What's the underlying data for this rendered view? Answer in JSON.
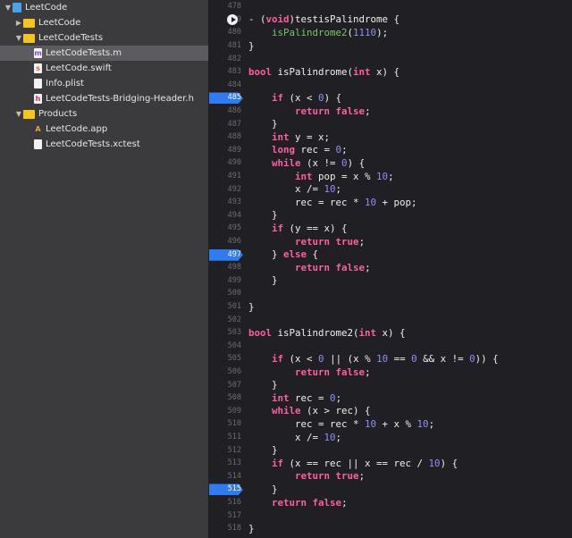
{
  "navigator": {
    "items": [
      {
        "label": "LeetCode",
        "level": 0,
        "icon": "project-icon",
        "disclosure": "open"
      },
      {
        "label": "LeetCode",
        "level": 1,
        "icon": "folder-icon",
        "disclosure": "closed"
      },
      {
        "label": "LeetCodeTests",
        "level": 1,
        "icon": "folder-icon",
        "disclosure": "open"
      },
      {
        "label": "LeetCodeTests.m",
        "level": 2,
        "icon": "objc-file-icon",
        "glyph": "m",
        "selected": true
      },
      {
        "label": "LeetCode.swift",
        "level": 2,
        "icon": "swift-file-icon",
        "glyph": "s"
      },
      {
        "label": "Info.plist",
        "level": 2,
        "icon": "plist-file-icon",
        "glyph": ""
      },
      {
        "label": "LeetCodeTests-Bridging-Header.h",
        "level": 2,
        "icon": "header-file-icon",
        "glyph": "h"
      },
      {
        "label": "Products",
        "level": 1,
        "icon": "folder-icon",
        "disclosure": "open"
      },
      {
        "label": "LeetCode.app",
        "level": 2,
        "icon": "app-icon",
        "glyph": "A"
      },
      {
        "label": "LeetCodeTests.xctest",
        "level": 2,
        "icon": "xctest-bundle-icon",
        "glyph": ""
      }
    ]
  },
  "colors": {
    "keyword": "#fc5fa3",
    "number": "#8f8ff5",
    "function": "#7bc46b",
    "breakpoint": "#2f7bf5"
  },
  "editor": {
    "lines": [
      {
        "n": "478",
        "t": []
      },
      {
        "n": "479",
        "run": true,
        "t": [
          [
            "p",
            "- ("
          ],
          [
            "k",
            "void"
          ],
          [
            "p",
            ")testisPalindrome {"
          ]
        ]
      },
      {
        "n": "480",
        "t": [
          [
            "p",
            "    "
          ],
          [
            "f",
            "isPalindrome2"
          ],
          [
            "p",
            "("
          ],
          [
            "n",
            "1110"
          ],
          [
            "p",
            ");"
          ]
        ]
      },
      {
        "n": "481",
        "t": [
          [
            "p",
            "}"
          ]
        ]
      },
      {
        "n": "482",
        "t": []
      },
      {
        "n": "483",
        "t": [
          [
            "k",
            "bool"
          ],
          [
            "p",
            " isPalindrome("
          ],
          [
            "k",
            "int"
          ],
          [
            "p",
            " x) {"
          ]
        ]
      },
      {
        "n": "484",
        "t": []
      },
      {
        "n": "485",
        "bp": true,
        "t": [
          [
            "p",
            "    "
          ],
          [
            "k",
            "if"
          ],
          [
            "p",
            " (x < "
          ],
          [
            "n",
            "0"
          ],
          [
            "p",
            ") {"
          ]
        ]
      },
      {
        "n": "486",
        "t": [
          [
            "p",
            "        "
          ],
          [
            "k",
            "return"
          ],
          [
            "p",
            " "
          ],
          [
            "k",
            "false"
          ],
          [
            "p",
            ";"
          ]
        ]
      },
      {
        "n": "487",
        "t": [
          [
            "p",
            "    }"
          ]
        ]
      },
      {
        "n": "488",
        "t": [
          [
            "p",
            "    "
          ],
          [
            "k",
            "int"
          ],
          [
            "p",
            " y = x;"
          ]
        ]
      },
      {
        "n": "489",
        "t": [
          [
            "p",
            "    "
          ],
          [
            "k",
            "long"
          ],
          [
            "p",
            " rec = "
          ],
          [
            "n",
            "0"
          ],
          [
            "p",
            ";"
          ]
        ]
      },
      {
        "n": "490",
        "t": [
          [
            "p",
            "    "
          ],
          [
            "k",
            "while"
          ],
          [
            "p",
            " (x != "
          ],
          [
            "n",
            "0"
          ],
          [
            "p",
            ") {"
          ]
        ]
      },
      {
        "n": "491",
        "t": [
          [
            "p",
            "        "
          ],
          [
            "k",
            "int"
          ],
          [
            "p",
            " pop = x % "
          ],
          [
            "n",
            "10"
          ],
          [
            "p",
            ";"
          ]
        ]
      },
      {
        "n": "492",
        "t": [
          [
            "p",
            "        x /= "
          ],
          [
            "n",
            "10"
          ],
          [
            "p",
            ";"
          ]
        ]
      },
      {
        "n": "493",
        "t": [
          [
            "p",
            "        rec = rec * "
          ],
          [
            "n",
            "10"
          ],
          [
            "p",
            " + pop;"
          ]
        ]
      },
      {
        "n": "494",
        "t": [
          [
            "p",
            "    }"
          ]
        ]
      },
      {
        "n": "495",
        "t": [
          [
            "p",
            "    "
          ],
          [
            "k",
            "if"
          ],
          [
            "p",
            " (y == x) {"
          ]
        ]
      },
      {
        "n": "496",
        "t": [
          [
            "p",
            "        "
          ],
          [
            "k",
            "return"
          ],
          [
            "p",
            " "
          ],
          [
            "k",
            "true"
          ],
          [
            "p",
            ";"
          ]
        ]
      },
      {
        "n": "497",
        "bp": true,
        "t": [
          [
            "p",
            "    } "
          ],
          [
            "k",
            "else"
          ],
          [
            "p",
            " {"
          ]
        ]
      },
      {
        "n": "498",
        "t": [
          [
            "p",
            "        "
          ],
          [
            "k",
            "return"
          ],
          [
            "p",
            " "
          ],
          [
            "k",
            "false"
          ],
          [
            "p",
            ";"
          ]
        ]
      },
      {
        "n": "499",
        "t": [
          [
            "p",
            "    }"
          ]
        ]
      },
      {
        "n": "500",
        "t": []
      },
      {
        "n": "501",
        "t": [
          [
            "p",
            "}"
          ]
        ]
      },
      {
        "n": "502",
        "t": []
      },
      {
        "n": "503",
        "t": [
          [
            "k",
            "bool"
          ],
          [
            "p",
            " isPalindrome2("
          ],
          [
            "k",
            "int"
          ],
          [
            "p",
            " x) {"
          ]
        ]
      },
      {
        "n": "504",
        "t": []
      },
      {
        "n": "505",
        "t": [
          [
            "p",
            "    "
          ],
          [
            "k",
            "if"
          ],
          [
            "p",
            " (x < "
          ],
          [
            "n",
            "0"
          ],
          [
            "p",
            " || (x % "
          ],
          [
            "n",
            "10"
          ],
          [
            "p",
            " == "
          ],
          [
            "n",
            "0"
          ],
          [
            "p",
            " && x != "
          ],
          [
            "n",
            "0"
          ],
          [
            "p",
            ")) {"
          ]
        ]
      },
      {
        "n": "506",
        "t": [
          [
            "p",
            "        "
          ],
          [
            "k",
            "return"
          ],
          [
            "p",
            " "
          ],
          [
            "k",
            "false"
          ],
          [
            "p",
            ";"
          ]
        ]
      },
      {
        "n": "507",
        "t": [
          [
            "p",
            "    }"
          ]
        ]
      },
      {
        "n": "508",
        "t": [
          [
            "p",
            "    "
          ],
          [
            "k",
            "int"
          ],
          [
            "p",
            " rec = "
          ],
          [
            "n",
            "0"
          ],
          [
            "p",
            ";"
          ]
        ]
      },
      {
        "n": "509",
        "t": [
          [
            "p",
            "    "
          ],
          [
            "k",
            "while"
          ],
          [
            "p",
            " (x > rec) {"
          ]
        ]
      },
      {
        "n": "510",
        "t": [
          [
            "p",
            "        rec = rec * "
          ],
          [
            "n",
            "10"
          ],
          [
            "p",
            " + x % "
          ],
          [
            "n",
            "10"
          ],
          [
            "p",
            ";"
          ]
        ]
      },
      {
        "n": "511",
        "t": [
          [
            "p",
            "        x /= "
          ],
          [
            "n",
            "10"
          ],
          [
            "p",
            ";"
          ]
        ]
      },
      {
        "n": "512",
        "t": [
          [
            "p",
            "    }"
          ]
        ]
      },
      {
        "n": "513",
        "t": [
          [
            "p",
            "    "
          ],
          [
            "k",
            "if"
          ],
          [
            "p",
            " (x == rec || x == rec / "
          ],
          [
            "n",
            "10"
          ],
          [
            "p",
            ") {"
          ]
        ]
      },
      {
        "n": "514",
        "t": [
          [
            "p",
            "        "
          ],
          [
            "k",
            "return"
          ],
          [
            "p",
            " "
          ],
          [
            "k",
            "true"
          ],
          [
            "p",
            ";"
          ]
        ]
      },
      {
        "n": "515",
        "bp": true,
        "t": [
          [
            "p",
            "    }"
          ]
        ]
      },
      {
        "n": "516",
        "t": [
          [
            "p",
            "    "
          ],
          [
            "k",
            "return"
          ],
          [
            "p",
            " "
          ],
          [
            "k",
            "false"
          ],
          [
            "p",
            ";"
          ]
        ]
      },
      {
        "n": "517",
        "t": []
      },
      {
        "n": "518",
        "t": [
          [
            "p",
            "}"
          ]
        ]
      }
    ]
  }
}
